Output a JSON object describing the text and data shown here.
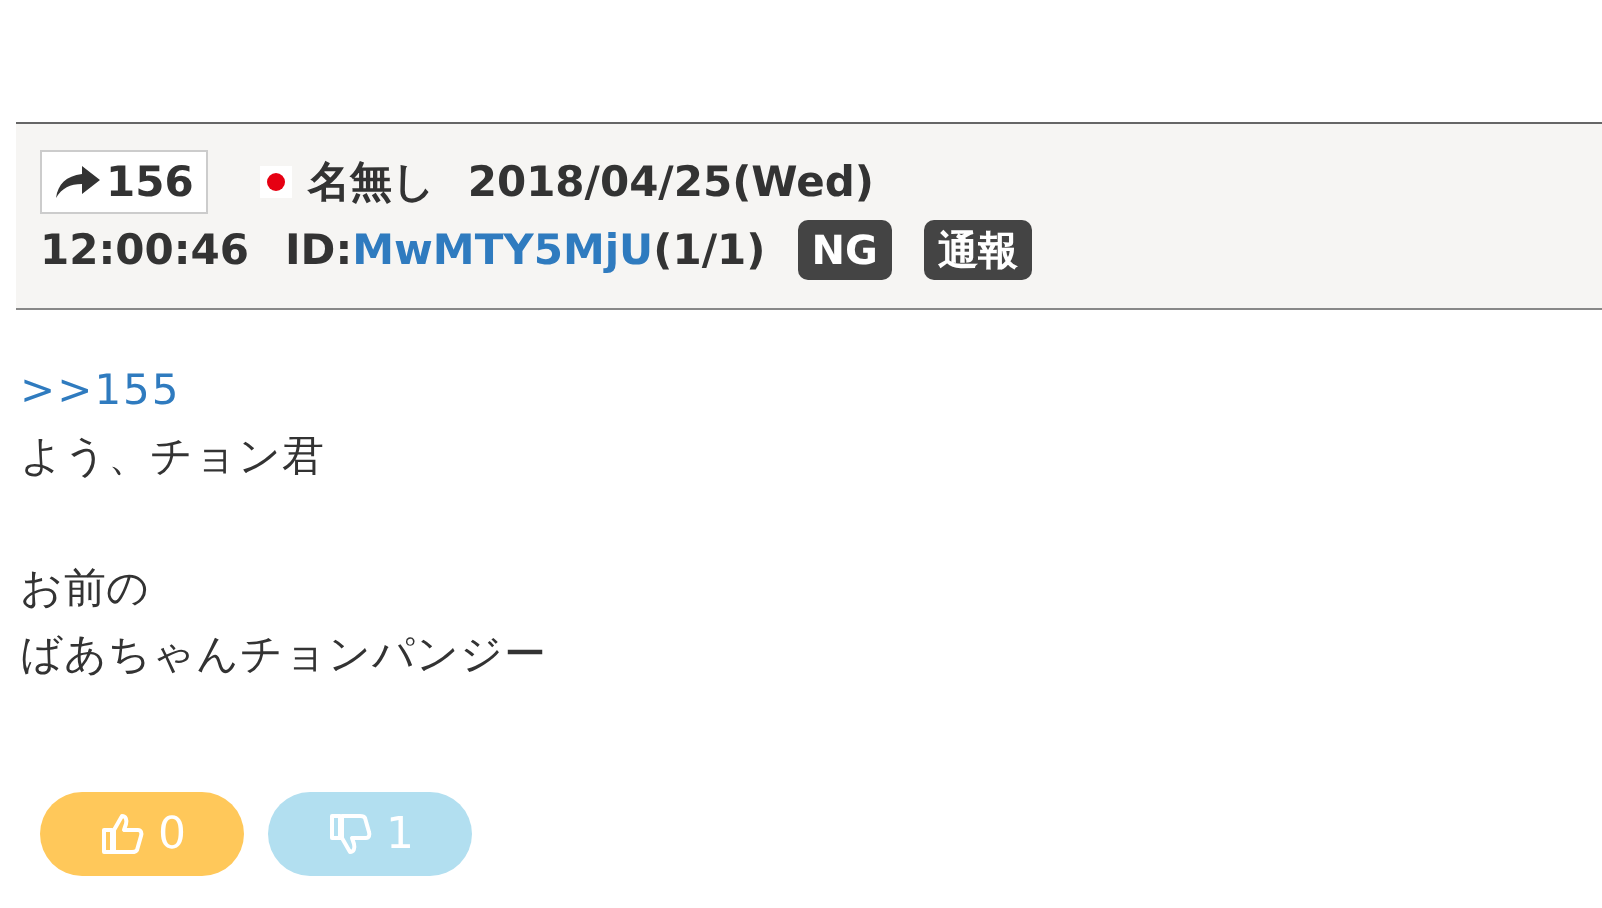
{
  "post": {
    "number": "156",
    "name": "名無し",
    "date": "2018/04/25(Wed)",
    "time": "12:00:46",
    "id_label": "ID:",
    "id": "MwMTY5MjU",
    "count": "(1/1)",
    "badges": [
      "NG",
      "通報"
    ],
    "body": [
      {
        "kind": "link",
        "text": ">>155"
      },
      {
        "kind": "text",
        "text": "よう、チョン君"
      },
      {
        "kind": "blank"
      },
      {
        "kind": "text",
        "text": "お前の"
      },
      {
        "kind": "text",
        "text": "ばあちゃんチョンパンジー"
      }
    ],
    "votes": [
      {
        "kind": "up",
        "count": "0"
      },
      {
        "kind": "down",
        "count": "1"
      }
    ]
  }
}
